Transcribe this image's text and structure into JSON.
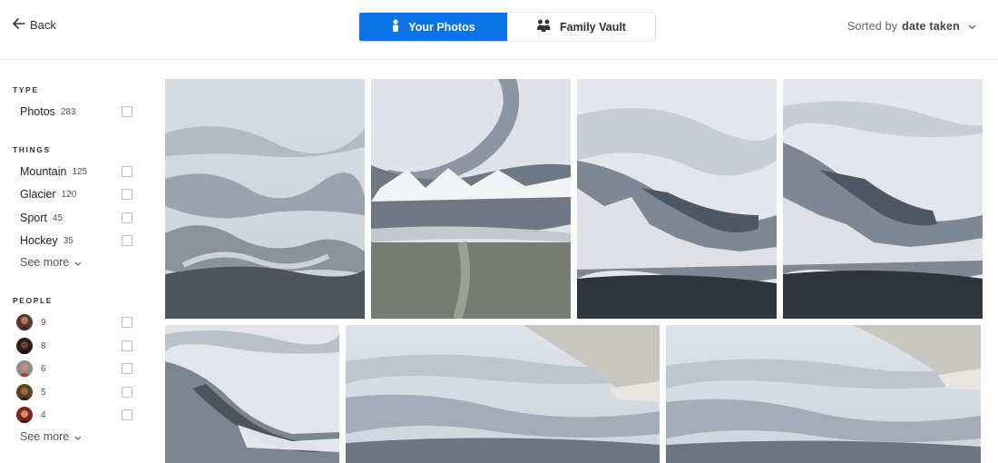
{
  "header": {
    "back_label": "Back",
    "tabs": [
      {
        "label": "Your Photos",
        "icon": "person-icon",
        "active": true
      },
      {
        "label": "Family Vault",
        "icon": "family-icon",
        "active": false
      }
    ],
    "sort_prefix": "Sorted by",
    "sort_value": "date taken"
  },
  "sidebar": {
    "type": {
      "title": "TYPE",
      "items": [
        {
          "label": "Photos",
          "count": "283"
        }
      ]
    },
    "things": {
      "title": "THINGS",
      "items": [
        {
          "label": "Mountain",
          "count": "125"
        },
        {
          "label": "Glacier",
          "count": "120"
        },
        {
          "label": "Sport",
          "count": "45"
        },
        {
          "label": "Hockey",
          "count": "35"
        }
      ],
      "see_more": "See more"
    },
    "people": {
      "title": "PEOPLE",
      "items": [
        {
          "count": "9"
        },
        {
          "count": "8"
        },
        {
          "count": "6"
        },
        {
          "count": "5"
        },
        {
          "count": "4"
        }
      ],
      "see_more": "See more"
    }
  },
  "colors": {
    "accent": "#0a73e6",
    "checkbox_border": "#bdbdbd"
  },
  "photos": [
    {
      "subject": "aerial-snowy-river-valley"
    },
    {
      "subject": "aerial-winding-river-mountains"
    },
    {
      "subject": "aerial-snowy-hills-river-bend"
    },
    {
      "subject": "aerial-snowy-hills-river-bend"
    },
    {
      "subject": "aerial-river-snowy-ridge"
    },
    {
      "subject": "aerial-view-with-plane-wing"
    },
    {
      "subject": "aerial-view-with-plane-wing"
    }
  ]
}
